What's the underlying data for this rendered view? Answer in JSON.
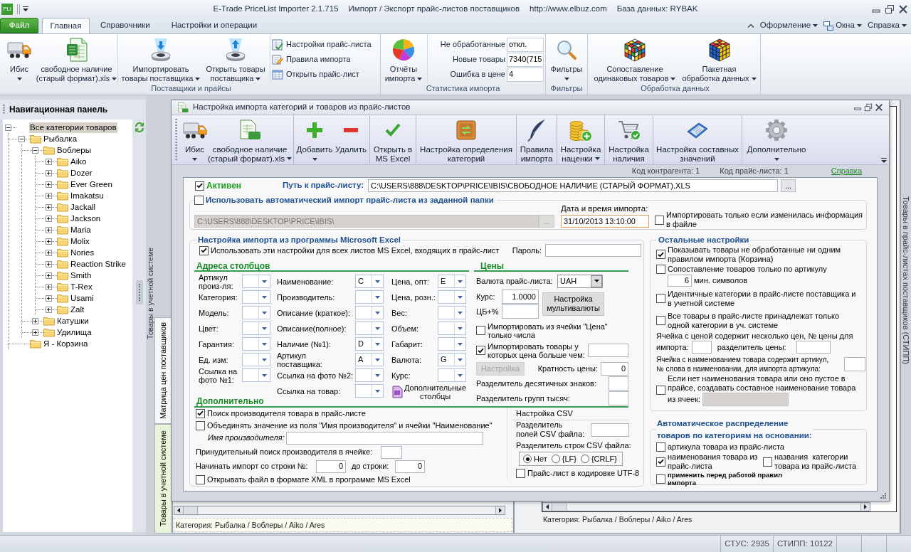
{
  "title_bar": {
    "logo": "PLi",
    "texts": [
      "E-Trade PriceList Importer 2.1.715",
      "Импорт / Экспорт прайс-листов поставщиков",
      "http://www.elbuz.com",
      "База данных: RYBAK"
    ]
  },
  "ribbon": {
    "tabs": [
      {
        "label": "Файл",
        "kind": "file",
        "selected": false
      },
      {
        "label": "Главная",
        "kind": "tab",
        "selected": true
      },
      {
        "label": "Справочники",
        "kind": "tab",
        "selected": false
      },
      {
        "label": "Настройки и операции",
        "kind": "tab",
        "selected": false
      }
    ],
    "menus": [
      {
        "label": "Оформление",
        "dropdown": true
      },
      {
        "label": "Окна",
        "dropdown": true
      },
      {
        "label": "Справка",
        "dropdown": true
      }
    ],
    "groups": [
      {
        "title": "Поставщики и прайсы",
        "sections": [
          [
            {
              "kind": "large",
              "label": "Ибис",
              "dropdown": true
            },
            {
              "kind": "large",
              "label": "свободное наличие\n(старый формат).xls",
              "dropdown": true
            }
          ],
          [
            {
              "kind": "large",
              "label": "Импортировать\nтовары поставщика",
              "dropdown": true
            },
            {
              "kind": "large",
              "label": "Открыть товары\nпоставщика",
              "dropdown": true
            }
          ],
          [
            {
              "kind": "small",
              "label": "Настройки прайс-листа"
            },
            {
              "kind": "small",
              "label": "Правила импорта"
            },
            {
              "kind": "small",
              "label": "Открыть прайс-лист"
            }
          ]
        ]
      },
      {
        "title": "Статистика импорта",
        "sections": [
          [
            {
              "kind": "large",
              "label": "Отчёты\nимпорта",
              "dropdown": true
            }
          ],
          [
            {
              "kind": "stat",
              "label": "Не обработанные",
              "value": "откл."
            },
            {
              "kind": "stat",
              "label": "Новые товары",
              "value": "7340(715"
            },
            {
              "kind": "stat",
              "label": "Ошибка в цене",
              "value": "4"
            }
          ]
        ]
      },
      {
        "title": "Фильтры",
        "sections": [
          [
            {
              "kind": "large",
              "label": "Фильтры",
              "dropdown": true
            }
          ]
        ]
      },
      {
        "title": "Обработка данных",
        "sections": [
          [
            {
              "kind": "large",
              "label": "Сопоставление\nодинаковых товаров",
              "dropdown": true
            },
            {
              "kind": "large",
              "label": "Пакетная\nобработка данных",
              "dropdown": true
            }
          ]
        ]
      }
    ]
  },
  "nav_panel": {
    "title": "Навигационная панель",
    "tree": [
      {
        "label": "Все категории товаров",
        "selected": true,
        "expanded": true,
        "children": [
          {
            "label": "Рыбалка",
            "selected": false,
            "expanded": true,
            "children": [
              {
                "label": "Воблеры",
                "selected": false,
                "expanded": true,
                "children": [
                  {
                    "label": "Aiko",
                    "selected": false,
                    "expanded": false
                  },
                  {
                    "label": "Dozer",
                    "selected": false,
                    "expanded": false
                  },
                  {
                    "label": "Ever Green",
                    "selected": false,
                    "expanded": false
                  },
                  {
                    "label": "Imakatsu",
                    "selected": false,
                    "expanded": false
                  },
                  {
                    "label": "Jackall",
                    "selected": false,
                    "expanded": false
                  },
                  {
                    "label": "Jackson",
                    "selected": false,
                    "expanded": false
                  },
                  {
                    "label": "Maria",
                    "selected": false,
                    "expanded": false
                  },
                  {
                    "label": "Molix",
                    "selected": false,
                    "expanded": false
                  },
                  {
                    "label": "Nories",
                    "selected": false,
                    "expanded": false
                  },
                  {
                    "label": "Reaction Strike",
                    "selected": false,
                    "expanded": false
                  },
                  {
                    "label": "Smith",
                    "selected": false,
                    "expanded": false
                  },
                  {
                    "label": "T-Rex",
                    "selected": false,
                    "expanded": false
                  },
                  {
                    "label": "Usami",
                    "selected": false,
                    "expanded": false
                  },
                  {
                    "label": "Zalt",
                    "selected": false,
                    "expanded": false
                  }
                ]
              },
              {
                "label": "Катушки",
                "selected": false,
                "expanded": false
              },
              {
                "label": "Удилища",
                "selected": false,
                "expanded": false
              }
            ]
          },
          {
            "label": "Я - Корзина",
            "selected": false
          }
        ]
      }
    ]
  },
  "workspace": {
    "left_window": {
      "side_label": "Товары в учетной системе",
      "status": "Категория: Рыбалка / Воблеры / Aiko / Ares"
    },
    "tabs": [
      {
        "label": "Матрица цен поставщиков",
        "selected": false
      },
      {
        "label": "Товары в учетной системе",
        "selected": true
      }
    ],
    "right_window": {
      "side_label": "Товары в прайс-листах поставщиков (СТИПП)",
      "status": "Категория: Рыбалка / Воблеры / Aiko / Ares"
    }
  },
  "dialog": {
    "title": "Настройка импорта категорий и товаров из прайс-листов",
    "toolbar": [
      [
        {
          "label": "Ибис",
          "dropdown": true
        },
        {
          "label": "свободное наличие\n(старый формат).xls",
          "dropdown": true
        }
      ],
      [
        {
          "label": "Добавить",
          "dropdown": true
        },
        {
          "label": "Удалить"
        }
      ],
      [
        {
          "label": "Открыть в\nMS Excel"
        }
      ],
      [
        {
          "label": "Настройка определения\nкатегорий"
        }
      ],
      [
        {
          "label": "Правила\nимпорта"
        }
      ],
      [
        {
          "label": "Настройка\nнаценки",
          "dropdown": true
        }
      ],
      [
        {
          "label": "Настройка\nналичия"
        }
      ],
      [
        {
          "label": "Настройка составных\nзначений"
        }
      ],
      [
        {
          "label": "Дополнительно",
          "dropdown": true
        }
      ]
    ],
    "info": [
      "Код контрагента: 1",
      "Код прайс-листа: 1"
    ],
    "help_link": "Справка",
    "active": {
      "label": "Активен",
      "checked": true
    },
    "path": {
      "label": "Путь к прайс-листу:",
      "value": "C:\\USERS\\888\\DESKTOP\\PRICE\\IBIS\\СВОБОДНОЕ НАЛИЧИЕ (СТАРЫЙ ФОРМАТ).XLS",
      "browse": "..."
    },
    "auto_import": {
      "label": "Использовать автоматический импорт прайс-листа из заданной папки",
      "checked": false,
      "folder": {
        "value": "C:\\USERS\\888\\DESKTOP\\PRICE\\IBIS\\",
        "disabled": true
      },
      "folder_browse": {
        "label": "...",
        "disabled": true
      },
      "date_label": "Дата и время импорта:",
      "date": {
        "value": "31/10/2013 13:10:00",
        "focused": true
      },
      "only_changed": {
        "label": "Импортировать только если изменилась информация\nв файле",
        "checked": false
      }
    },
    "excel": {
      "title": "Настройка импорта из программы Microsoft Excel",
      "all_sheets": {
        "label": "Использовать эти настройки для всех листов MS Excel, входящих в прайс-лист",
        "checked": true
      },
      "password_label": "Пароль:",
      "columns_title": "Адреса столбцов",
      "columns": [
        [
          {
            "label": "Артикул\nпроиз-ля:"
          },
          {
            "label": "Категория:"
          },
          {
            "label": "Модель:"
          },
          {
            "label": "Цвет:"
          },
          {
            "label": "Гарантия:"
          },
          {
            "label": "Ед. изм:"
          },
          {
            "label": "Ссылка на\nфото №1:"
          }
        ],
        [
          {
            "label": "Наименование:",
            "value": "C"
          },
          {
            "label": "Производитель:"
          },
          {
            "label": "Описание (краткое):"
          },
          {
            "label": "Описание(полное):"
          },
          {
            "label": "Наличие (№1):",
            "value": "D"
          },
          {
            "label": "Артикул\nпоставщика:",
            "value": "A"
          },
          {
            "label": "Ссылка на фото №2:"
          },
          {
            "label": "Ссылка на товар:"
          }
        ],
        [
          {
            "label": "Цена, опт:",
            "value": "E"
          },
          {
            "label": "Цена, розн.:"
          },
          {
            "label": "Вес:"
          },
          {
            "label": "Объем:"
          },
          {
            "label": "Габарит:"
          },
          {
            "label": "Валюта:",
            "value": "G"
          },
          {
            "label": "Курс:"
          }
        ]
      ],
      "extra_columns": "Дополнительные\nстолбцы",
      "prices": {
        "title": "Цены",
        "currency": {
          "label": "Валюта прайс-листа:",
          "value": "UAH"
        },
        "rate": {
          "label": "Курс:",
          "value": "1.0000"
        },
        "multicurrency": "Настройка\nмультивалюты",
        "cb_label": "ЦБ+%",
        "numbers_only": {
          "label": "Импортировать из ячейки \"Цена\"\nтолько числа",
          "checked": false
        },
        "min_price": {
          "label": "Импортировать товары у\nкоторых цена больше чем:",
          "checked": true
        },
        "setup": {
          "label": "Настройка",
          "disabled": true
        },
        "multiplicity": {
          "label": "Кратность цены:",
          "value": "0"
        },
        "decimal_label": "Разделитель десятичных знаков:",
        "thousands_label": "Разделитель групп тысяч:"
      },
      "extra_title": "Дополнительно",
      "options": {
        "find_maker": {
          "label": "Поиск производителя товара в прайс-листе",
          "checked": true
        },
        "merge": {
          "label": "Объединять значение из поля \"Имя производителя\" и ячейки \"Наименование\"",
          "checked": false
        },
        "maker_name_label": "Имя производителя:",
        "forced_label": "Принудительный поиск производителя в ячейке:",
        "start_row": {
          "label": "Начинать импорт со строки №:",
          "value": "0"
        },
        "end_row": {
          "label": "до строки:",
          "value": "0"
        },
        "xml": {
          "label": "Открывать файл в формате XML в программе MS Excel",
          "checked": false
        }
      },
      "csv": {
        "title": "Настройка CSV",
        "field_sep_label": "Разделитель\nполей CSV файла:",
        "row_sep_label": "Разделитель строк CSV файла:",
        "row_sep": [
          {
            "label": "Нет",
            "selected": true
          },
          {
            "label": "{LF}",
            "selected": false
          },
          {
            "label": "{CRLF}",
            "selected": false
          }
        ],
        "utf8": {
          "label": "Прайс-лист в кодировке UTF-8",
          "checked": false
        }
      }
    },
    "other": {
      "title": "Остальные настройки",
      "show_unprocessed": {
        "label": "Показывать товары не обработанные ни одним\nправилом импорта (Корзина)",
        "checked": true
      },
      "match_by_sku": {
        "label": "Сопоставление товаров только по артикулу",
        "checked": false
      },
      "min_chars": {
        "value": "6",
        "label": "мин. символов"
      },
      "identical_categories": {
        "label": "Идентичные категории в прайс-листе поставщика и\nв учетной системе",
        "checked": false
      },
      "single_category": {
        "label": "Все товары в прайс-листе принадлежат только\nодной категории в уч. системе",
        "checked": false
      },
      "multi_price": {
        "line1": "Ячейка с ценой содержит несколько цен, № цены для",
        "line2": "импорта:",
        "separator_label": "разделитель цены:"
      },
      "sku_in_name": "Ячейка с наименованием товара содержит артикул,\n№ слова в наименовании, для импорта артикула:",
      "compose_name": {
        "label": "Если нет наименования товара или оно пустое в\nпрайсе, создавать составное наименование товара",
        "tail": "из ячеек:",
        "checked": false,
        "field_disabled": true
      }
    },
    "auto_distribution": {
      "title": "Автоматическое распределение\nтоваров по категориям на основании:",
      "items": [
        {
          "label": "артикула товара из прайс-листа",
          "checked": false
        },
        {
          "label": "наименования товара из\nпрайс-листа",
          "checked": true
        },
        {
          "label": "названия  категории\nтовара из прайс-листа",
          "checked": false
        },
        {
          "label": "применить перед работой правил\nимпорта",
          "checked": false
        }
      ]
    }
  },
  "status_bar": {
    "panels": [
      "СТУС: 2935",
      "СТИПП: 10122"
    ]
  }
}
